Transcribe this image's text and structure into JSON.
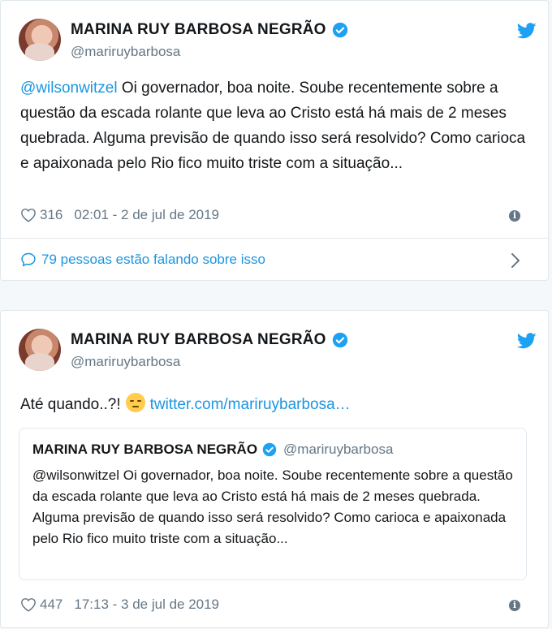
{
  "tweets": [
    {
      "name": "MARINA RUY BARBOSA NEGRÃO",
      "handle": "@mariruybarbosa",
      "mention": "@wilsonwitzel",
      "text": " Oi governador, boa noite. Soube recentemente sobre a questão da escada rolante que leva ao Cristo está há mais de 2 meses quebrada. Alguma previsão de quando isso será resolvido? Como carioca e apaixonada pelo Rio fico muito triste com a situação...",
      "likes": "316",
      "timestamp": "02:01 - 2 de jul de 2019",
      "conversation": "79 pessoas estão falando sobre isso"
    },
    {
      "name": "MARINA RUY BARBOSA NEGRÃO",
      "handle": "@mariruybarbosa",
      "text": "Até quando..?!",
      "link": "twitter.com/mariruybarbosa…",
      "likes": "447",
      "timestamp": "17:13 - 3 de jul de 2019",
      "quote": {
        "name": "MARINA RUY BARBOSA NEGRÃO",
        "handle": "@mariruybarbosa",
        "text": "@wilsonwitzel Oi governador, boa noite. Soube recentemente sobre a questão da escada rolante que leva ao Cristo está há mais de 2 meses quebrada. Alguma previsão de quando isso será resolvido? Como carioca e apaixonada pelo Rio fico muito triste com a situação..."
      }
    }
  ],
  "colors": {
    "link": "#1b95e0",
    "muted": "#657786",
    "border": "#e1e8ed"
  },
  "icons": [
    "avatar",
    "verified-badge-icon",
    "twitter-bird-icon",
    "heart-icon",
    "info-icon",
    "speech-bubble-icon",
    "chevron-right-icon",
    "pensive-face-emoji"
  ]
}
